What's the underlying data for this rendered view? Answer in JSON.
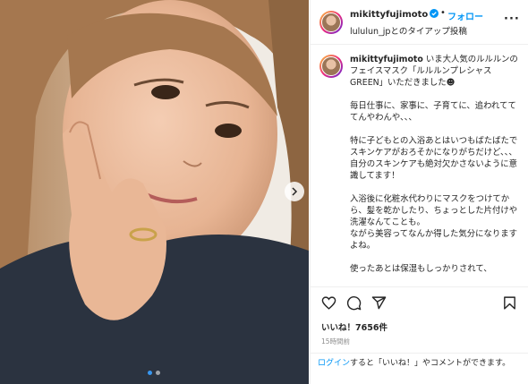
{
  "post": {
    "username": "mikittyfujimoto",
    "separator": "•",
    "follow_label": "フォロー",
    "subtitle": "lululun_jpとのタイアップ投稿",
    "more_label": "···"
  },
  "caption": {
    "username": "mikittyfujimoto",
    "paragraphs": [
      "いま大人気のルルルンのフェイスマスク「ルルルンプレシャス GREEN」いただきました☻",
      "毎日仕事に、家事に、子育てに、追われてててんやわんや、、、",
      "特に子どもとの入浴あとはいつもばたばたでスキンケアがおろそかになりがちだけど、、、\n自分のスキンケアも絶対欠かさないように意識してます！",
      "入浴後に化粧水代わりにマスクをつけてから、髪を乾かしたり、ちょっとした片付けや洗濯なんてことも。\nながら美容ってなんか得した気分になりますよね。",
      "使ったあとは保湿もしっかりされて、"
    ]
  },
  "actions": {
    "like_icon": "heart-icon",
    "comment_icon": "comment-icon",
    "share_icon": "share-icon",
    "save_icon": "bookmark-icon"
  },
  "likes_text": "いいね！7656件",
  "time_text": "15時間前",
  "login": {
    "link_text": "ログイン",
    "rest_text": "すると「いいね！」やコメントができます。"
  },
  "carousel": {
    "total_dots": 2,
    "active_dot": 1
  },
  "colors": {
    "accent": "#0095f6",
    "border": "#efefef",
    "text": "#262626",
    "muted": "#8e8e8e"
  }
}
